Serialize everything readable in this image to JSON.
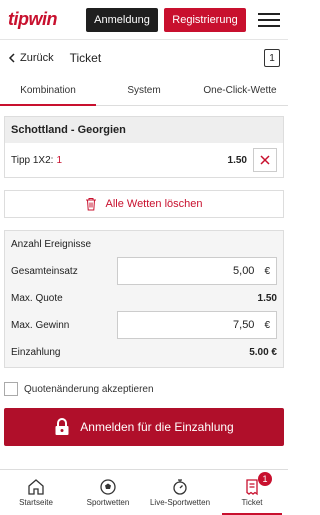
{
  "header": {
    "logo": "tipwin",
    "login_label": "Anmeldung",
    "register_label": "Registrierung"
  },
  "subheader": {
    "back_label": "Zurück",
    "title": "Ticket",
    "ticket_count": "1"
  },
  "tabs": [
    {
      "label": "Kombination",
      "active": true
    },
    {
      "label": "System",
      "active": false
    },
    {
      "label": "One-Click-Wette",
      "active": false
    }
  ],
  "bet": {
    "match": "Schottland - Georgien",
    "tipp_label": "Tipp 1X2:",
    "tipp_value": "1",
    "odds": "1.50"
  },
  "delete_all_label": "Alle Wetten löschen",
  "stake": {
    "events_label": "Anzahl Ereignisse",
    "total_stake_label": "Gesamteinsatz",
    "total_stake_value": "5,00",
    "currency": "€",
    "max_quote_label": "Max. Quote",
    "max_quote_value": "1.50",
    "max_win_label": "Max. Gewinn",
    "max_win_value": "7,50",
    "payin_label": "Einzahlung",
    "payin_value": "5.00 €"
  },
  "accept_label": "Quotenänderung akzeptieren",
  "cta_label": "Anmelden für die Einzahlung",
  "bottom_nav": [
    {
      "label": "Startseite",
      "icon": "home-icon"
    },
    {
      "label": "Sportwetten",
      "icon": "soccer-ball-icon"
    },
    {
      "label": "Live-Sportwetten",
      "icon": "stopwatch-icon"
    },
    {
      "label": "Ticket",
      "icon": "ticket-icon",
      "badge": "1"
    }
  ],
  "colors": {
    "brand": "#c8102e",
    "dark": "#1f1f1f",
    "cta": "#b00f2a"
  }
}
